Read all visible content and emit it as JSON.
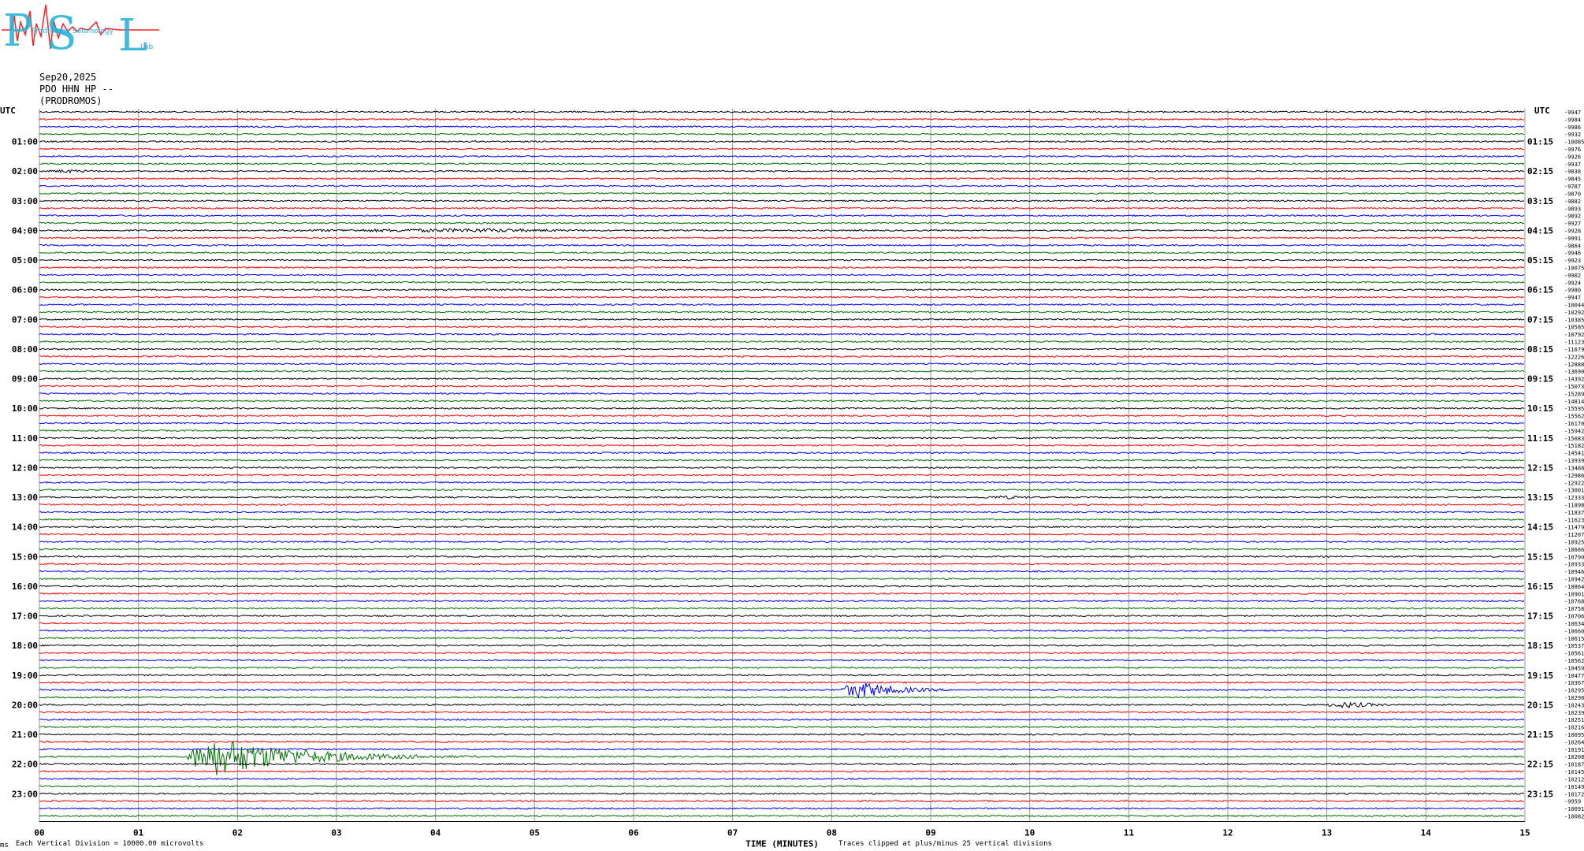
{
  "logo": {
    "letters": [
      "P",
      "S",
      "L"
    ],
    "words": [
      "Prodromos",
      "Seismology",
      "Lab"
    ],
    "colors": {
      "letters": "#20b0d8",
      "trace": "#ff2020"
    }
  },
  "header": {
    "date": "Sep20,2025",
    "channel": "PDO HHN HP --",
    "station": "(PRODROMOS)"
  },
  "footer": {
    "scale_note": "Each Vertical Division = 10000.00 microvolts",
    "axis_title": "TIME (MINUTES)",
    "clip_note": "Traces clipped at plus/minus 25 vertical divisions",
    "corner_mark": "ms"
  },
  "chart_data": {
    "type": "line",
    "subtype": "helicorder",
    "x_unit": "minutes",
    "xlim": [
      0,
      15
    ],
    "x_ticks": [
      "00",
      "01",
      "02",
      "03",
      "04",
      "05",
      "06",
      "07",
      "08",
      "09",
      "10",
      "11",
      "12",
      "13",
      "14",
      "15"
    ],
    "left_axis_label": "UTC",
    "right_axis_label": "UTC",
    "hour_labels_left": [
      "01:00",
      "02:00",
      "03:00",
      "04:00",
      "05:00",
      "06:00",
      "07:00",
      "08:00",
      "09:00",
      "10:00",
      "11:00",
      "12:00",
      "13:00",
      "14:00",
      "15:00",
      "16:00",
      "17:00",
      "18:00",
      "19:00",
      "20:00",
      "21:00",
      "22:00",
      "23:00"
    ],
    "hour_labels_right": [
      "01:15",
      "02:15",
      "03:15",
      "04:15",
      "05:15",
      "06:15",
      "07:15",
      "08:15",
      "09:15",
      "10:15",
      "11:15",
      "12:15",
      "13:15",
      "14:15",
      "15:15",
      "16:15",
      "17:15",
      "18:15",
      "19:15",
      "20:15",
      "21:15",
      "22:15",
      "23:15"
    ],
    "trace_color_cycle": [
      "#000000",
      "#ff0000",
      "#0000ff",
      "#007000"
    ],
    "trace_count": 96,
    "trace_minutes": 15,
    "trace_offsets": [
      "-9947",
      "-9984",
      "-9986",
      "-9932",
      "-10085",
      "-9976",
      "-9926",
      "-9937",
      "-9838",
      "-9845",
      "-9787",
      "-9870",
      "-9882",
      "-9893",
      "-9892",
      "-9927",
      "-9928",
      "-9991",
      "-9864",
      "-9946",
      "-9923",
      "-10075",
      "-9902",
      "-9924",
      "-9980",
      "-9947",
      "-10044",
      "-10292",
      "-10385",
      "-10585",
      "-10792",
      "-11123",
      "-11679",
      "-12226",
      "-12888",
      "-13690",
      "-14392",
      "-15073",
      "-15289",
      "-14814",
      "-15595",
      "-15562",
      "-16170",
      "-15942",
      "-15083",
      "-15182",
      "-14541",
      "-13939",
      "-13488",
      "-12986",
      "-12922",
      "-13001",
      "-12333",
      "-11898",
      "-11837",
      "-11623",
      "-11479",
      "-11207",
      "-10925",
      "-10666",
      "-10790",
      "-10933",
      "-10946",
      "-10942",
      "-10864",
      "-10901",
      "-10768",
      "-10758",
      "-10706",
      "-10634",
      "-10660",
      "-10615",
      "-10537",
      "-10561",
      "-10562",
      "-10459",
      "-10477",
      "-10367",
      "-10295",
      "-10298",
      "-10243",
      "-10239",
      "-10251",
      "-10216",
      "-10095",
      "-10264",
      "-10191",
      "-10208",
      "-10187",
      "-10145",
      "-10212",
      "-10149",
      "-10172",
      "-9959",
      "-10091",
      "-10082"
    ],
    "events": [
      {
        "trace": 1,
        "start_min": 2.5,
        "end_min": 3.0,
        "amp": 0.8,
        "dur": 0.8
      },
      {
        "trace": 4,
        "start_min": 5.6,
        "end_min": 6.1,
        "amp": 1.0,
        "dur": 0.6
      },
      {
        "trace": 8,
        "start_min": 0.0,
        "end_min": 0.3,
        "amp": 2.2,
        "dur": 1.2
      },
      {
        "trace": 16,
        "start_min": 2.3,
        "end_min": 4.5,
        "amp": 2.6,
        "dur": 3.5
      },
      {
        "trace": 16,
        "start_min": 5.0,
        "end_min": 5.6,
        "amp": 0.8,
        "dur": 1.0
      },
      {
        "trace": 41,
        "start_min": 1.2,
        "end_min": 1.6,
        "amp": 1.6,
        "dur": 0.7
      },
      {
        "trace": 52,
        "start_min": 9.4,
        "end_min": 9.8,
        "amp": 2.2,
        "dur": 0.9
      },
      {
        "trace": 56,
        "start_min": 4.3,
        "end_min": 4.5,
        "amp": 1.4,
        "dur": 0.4
      },
      {
        "trace": 62,
        "start_min": 8.0,
        "end_min": 8.1,
        "amp": 1.2,
        "dur": 0.4
      },
      {
        "trace": 78,
        "start_min": 0.5,
        "end_min": 0.7,
        "amp": 1.8,
        "dur": 0.6
      },
      {
        "trace": 78,
        "start_min": 8.1,
        "end_min": 8.3,
        "amp": 11.0,
        "dur": 1.2
      },
      {
        "trace": 80,
        "start_min": 13.0,
        "end_min": 13.2,
        "amp": 4.2,
        "dur": 1.0
      },
      {
        "trace": 87,
        "start_min": 1.5,
        "end_min": 1.8,
        "amp": 24.0,
        "dur": 2.6
      },
      {
        "trace": 87,
        "start_min": 8.8,
        "end_min": 9.0,
        "amp": 1.0,
        "dur": 0.5
      },
      {
        "trace": 93,
        "start_min": 0.1,
        "end_min": 0.2,
        "amp": 1.0,
        "dur": 0.4
      }
    ]
  }
}
